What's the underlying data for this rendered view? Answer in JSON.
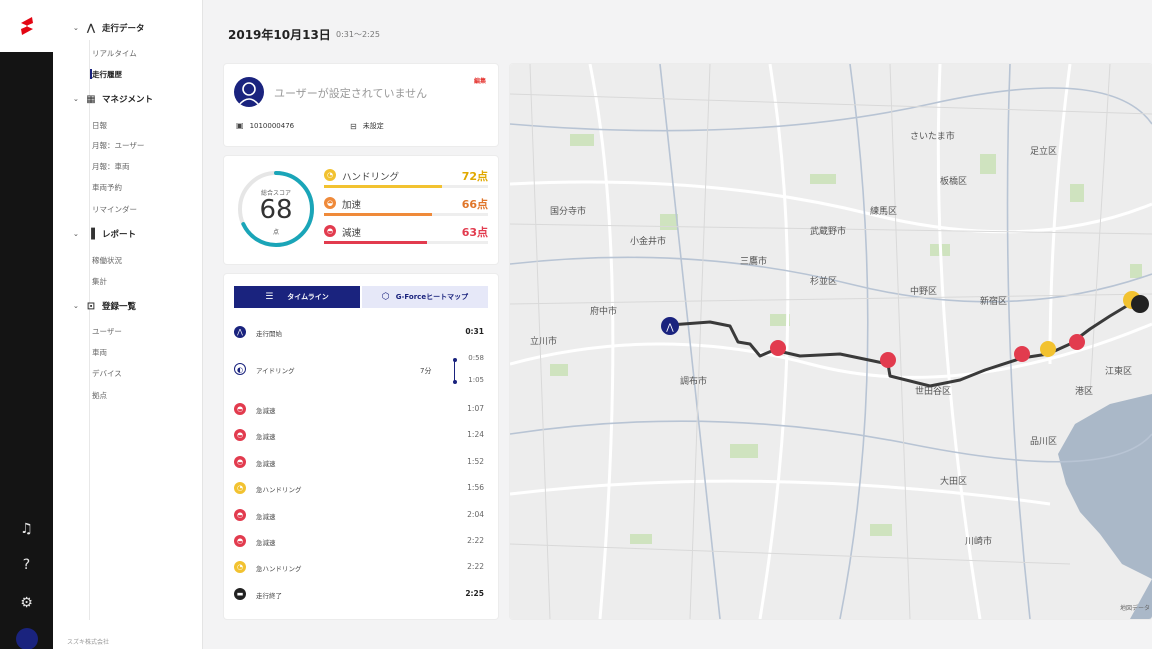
{
  "menu": {
    "sections": [
      {
        "label": "走行データ",
        "icon": "route-icon",
        "items": [
          {
            "label": "リアルタイム"
          },
          {
            "label": "走行履歴"
          }
        ]
      },
      {
        "label": "マネジメント",
        "icon": "calendar-icon",
        "items": [
          {
            "label": "日報"
          },
          {
            "label": "月報：ユーザー"
          },
          {
            "label": "月報：車両"
          },
          {
            "label": "車両予約"
          },
          {
            "label": "リマインダー"
          }
        ]
      },
      {
        "label": "レポート",
        "icon": "chart-icon",
        "items": [
          {
            "label": "稼働状況"
          },
          {
            "label": "集計"
          }
        ]
      },
      {
        "label": "登録一覧",
        "icon": "briefcase-icon",
        "items": [
          {
            "label": "ユーザー"
          },
          {
            "label": "車両"
          },
          {
            "label": "デバイス"
          },
          {
            "label": "拠点"
          }
        ]
      }
    ],
    "footer": "スズキ株式会社"
  },
  "header": {
    "date": "2019年10月13日",
    "time_range": "0:31〜2:25"
  },
  "user": {
    "name": "ユーザーが設定されていません",
    "edit": "編集",
    "device_id": "1010000476",
    "vehicle": "未設定"
  },
  "score": {
    "label": "総合スコア",
    "value": "68",
    "unit": "点",
    "metrics": [
      {
        "name": "ハンドリング",
        "value": "72点",
        "pct": 72,
        "color": "#f2c230",
        "icon_color": "#f2c230"
      },
      {
        "name": "加速",
        "value": "66点",
        "pct": 66,
        "color": "#ef8a3a",
        "icon_color": "#ef8a3a"
      },
      {
        "name": "減速",
        "value": "63点",
        "pct": 63,
        "color": "#e23b4e",
        "icon_color": "#e23b4e"
      }
    ]
  },
  "tabs": {
    "timeline": "タイムライン",
    "heatmap": "G-Forceヒートマップ"
  },
  "timeline": {
    "start": {
      "label": "走行開始",
      "time": "0:31"
    },
    "idling": {
      "label": "アイドリング",
      "duration": "7分",
      "from": "0:58",
      "to": "1:05"
    },
    "events": [
      {
        "label": "急減速",
        "time": "1:07",
        "type": "decel"
      },
      {
        "label": "急減速",
        "time": "1:24",
        "type": "decel"
      },
      {
        "label": "急減速",
        "time": "1:52",
        "type": "decel"
      },
      {
        "label": "急ハンドリング",
        "time": "1:56",
        "type": "handling"
      },
      {
        "label": "急減速",
        "time": "2:04",
        "type": "decel"
      },
      {
        "label": "急減速",
        "time": "2:22",
        "type": "decel"
      },
      {
        "label": "急ハンドリング",
        "time": "2:22",
        "type": "handling"
      }
    ],
    "end": {
      "label": "走行終了",
      "time": "2:25"
    }
  },
  "map": {
    "labels": [
      "さいたま市",
      "世田谷区",
      "川崎市",
      "新宿区",
      "中野区",
      "杉並区",
      "練馬区",
      "港区",
      "品川区",
      "大田区",
      "府中市",
      "調布市",
      "三鷹市",
      "武蔵野市",
      "小金井市",
      "国分寺市",
      "立川市",
      "江東区",
      "足立区",
      "板橋区"
    ],
    "credit": "地図データ"
  }
}
